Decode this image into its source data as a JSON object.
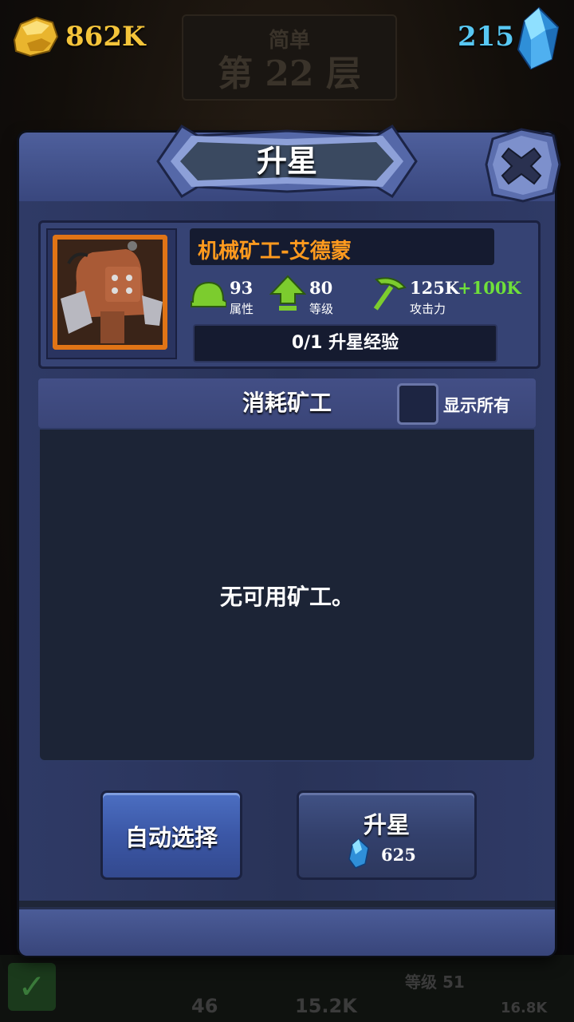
{
  "hud": {
    "gold_icon": "gold-nugget-icon",
    "gold_amount": "862K",
    "gem_amount": "215",
    "gem_icon": "blue-crystal-icon"
  },
  "background": {
    "difficulty": "简单",
    "floor": "第 22 层",
    "level": "等级 51",
    "stat_a": "46",
    "stat_b": "15.2K",
    "stat_c": "16.8K"
  },
  "dialog": {
    "title": "升星",
    "close_icon": "close-x-icon"
  },
  "hero": {
    "name": "机械矿工-艾德蒙",
    "portrait_icon": "mech-miner-portrait",
    "stats": [
      {
        "icon": "helmet-icon",
        "value": "93",
        "label": "属性"
      },
      {
        "icon": "level-up-arrow-icon",
        "value": "80",
        "label": "等级"
      },
      {
        "icon": "pickaxe-icon",
        "value": "125K",
        "bonus": "+100K",
        "label": "攻击力"
      }
    ],
    "exp_text": "0/1 升星经验"
  },
  "consume": {
    "title": "消耗矿工",
    "show_all_label": "显示所有",
    "show_all_checked": false,
    "empty_message": "无可用矿工。"
  },
  "buttons": {
    "auto_select": "自动选择",
    "star_up": "升星",
    "star_up_cost": "625"
  },
  "colors": {
    "gold": "#f4c43a",
    "gem": "#58c8f4",
    "hero_name": "#ff9a1e",
    "bonus": "#6fe03a",
    "panel": "#2f3a66"
  }
}
